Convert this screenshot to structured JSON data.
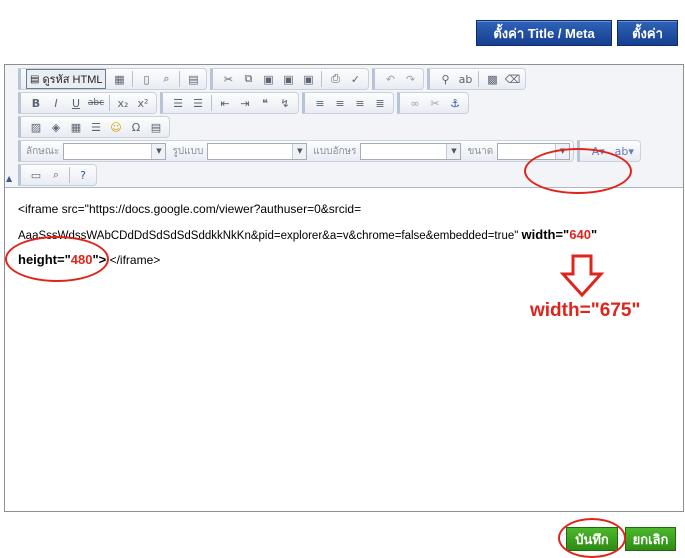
{
  "top_buttons": {
    "title_meta": "ตั้งค่า Title / Meta",
    "settings": "ตั้งค่า"
  },
  "toolbar": {
    "source_label": "ดูรหัส HTML",
    "combos": {
      "style_label": "ลักษณะ",
      "format_label": "รูปแบบ",
      "font_label": "แบบอักษร",
      "size_label": "ขนาด"
    }
  },
  "content": {
    "line1": "<iframe src=\"https://docs.google.com/viewer?authuser=0&srcid=",
    "line2_prefix": "AaaSssWdssWAbCDdDdSdSdSdSddkkNkKn&pid=explorer&a=v&chrome=false&embedded=true\" ",
    "line2_attr": "width=\"",
    "line2_value": "640",
    "line2_close": "\"",
    "line3_attr": "height=\"",
    "line3_value": "480",
    "line3_close": "\">",
    "line3_suffix": "</iframe>"
  },
  "annotation": {
    "new_width": "width=\"675\"",
    "color": "#e0241b"
  },
  "bottom_buttons": {
    "save": "บันทึก",
    "cancel": "ยกเลิก"
  },
  "colors": {
    "top_button": "#1f4fa3",
    "bottom_button": "#3aa01e",
    "highlight": "#e0241b"
  }
}
